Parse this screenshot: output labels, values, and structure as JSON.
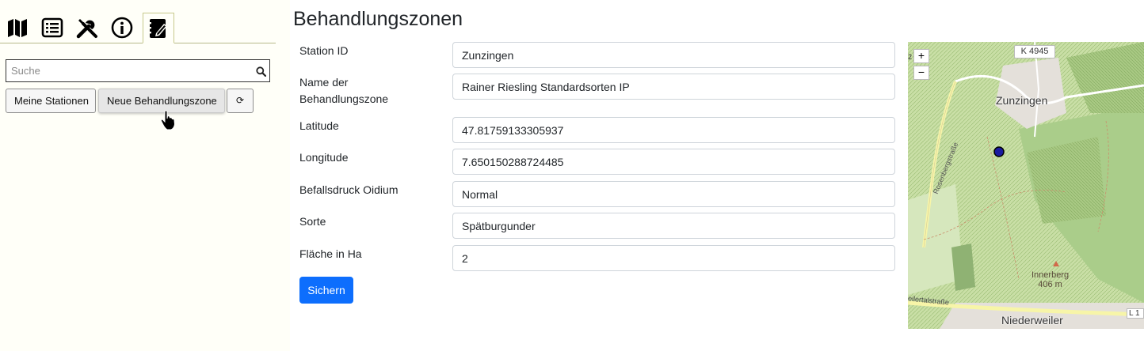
{
  "sidebar": {
    "tabs": [
      {
        "icon": "map-icon"
      },
      {
        "icon": "list-icon"
      },
      {
        "icon": "tools-icon"
      },
      {
        "icon": "info-icon"
      },
      {
        "icon": "edit-notebook-icon",
        "active": true
      }
    ],
    "search": {
      "placeholder": "Suche",
      "value": ""
    },
    "buttons": {
      "my_stations": "Meine Stationen",
      "new_zone": "Neue Behandlungszone",
      "refresh": "⟳"
    }
  },
  "main": {
    "title": "Behandlungszonen",
    "fields": {
      "station_id": {
        "label": "Station ID",
        "value": "Zunzingen"
      },
      "zone_name": {
        "label": "Name der Behandlungszone",
        "value": "Rainer Riesling Standardsorten IP"
      },
      "latitude": {
        "label": "Latitude",
        "value": "47.81759133305937"
      },
      "longitude": {
        "label": "Longitude",
        "value": "7.650150288724485"
      },
      "oidium": {
        "label": "Befallsdruck Oidium",
        "value": "Normal"
      },
      "variety": {
        "label": "Sorte",
        "value": "Spätburgunder"
      },
      "area": {
        "label": "Fläche in Ha",
        "value": "2"
      }
    },
    "save_label": "Sichern"
  },
  "map": {
    "zoom_in": "+",
    "zoom_out": "−",
    "labels": {
      "road_k4945": "K 4945",
      "town_zunzingen": "Zunzingen",
      "street_rosenberg": "Rosenbergstraße",
      "peak_name": "Innerberg",
      "peak_elev": "406 m",
      "town_niederweiler": "Niederweiler",
      "street_weilertal": "eilertalstraße",
      "road_l": "L 1",
      "edge_digit": "2"
    },
    "colors": {
      "marker": "#1a1aa0",
      "forest": "#a8cc8c",
      "vineyard": "#cfe3b0",
      "road_yellow": "#f7f5a8"
    }
  }
}
